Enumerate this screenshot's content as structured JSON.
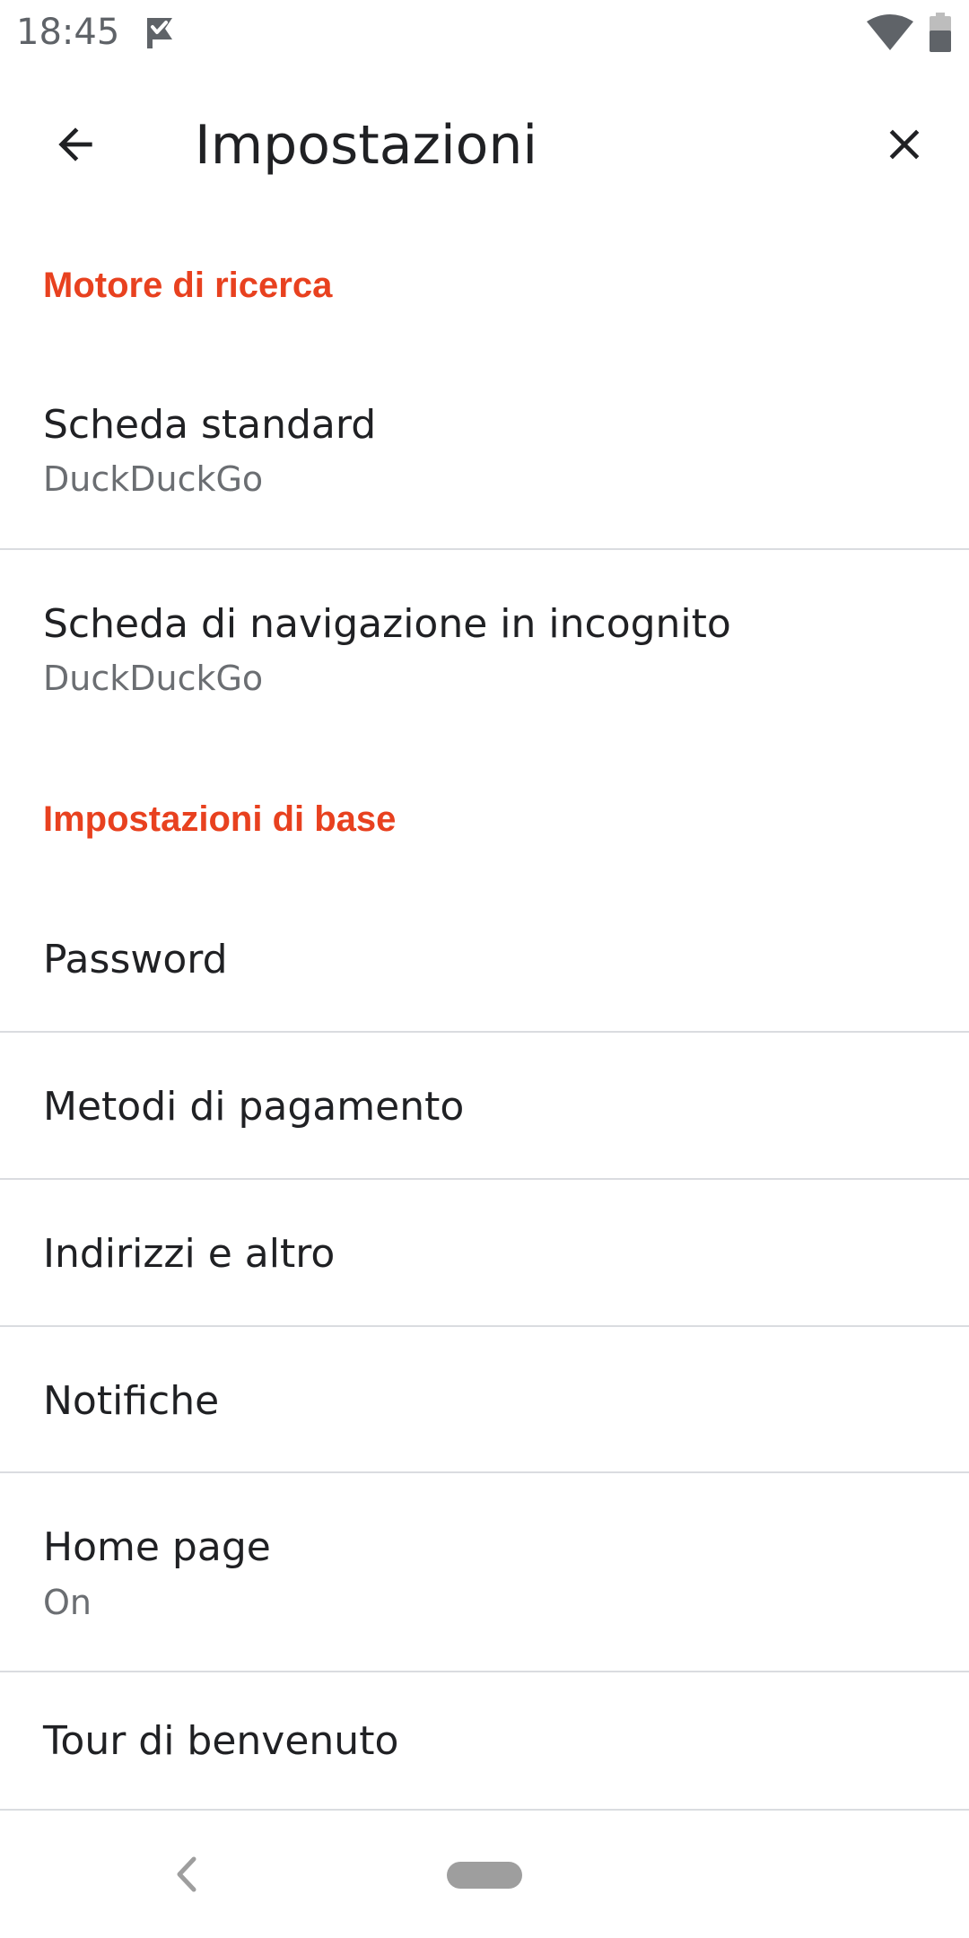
{
  "status_bar": {
    "time": "18:45",
    "app_icon": "check-flag-icon",
    "wifi_icon": "wifi-icon",
    "battery_icon": "battery-icon"
  },
  "toolbar": {
    "title": "Impostazioni",
    "back_icon": "arrow-back-icon",
    "close_icon": "close-icon"
  },
  "sections": {
    "search_engine": {
      "header": "Motore di ricerca",
      "items": [
        {
          "title": "Scheda standard",
          "summary": "DuckDuckGo"
        },
        {
          "title": "Scheda di navigazione in incognito",
          "summary": "DuckDuckGo"
        }
      ]
    },
    "basics": {
      "header": "Impostazioni di base",
      "items": [
        {
          "title": "Password"
        },
        {
          "title": "Metodi di pagamento"
        },
        {
          "title": "Indirizzi e altro"
        },
        {
          "title": "Notifiche"
        },
        {
          "title": "Home page",
          "summary": "On"
        },
        {
          "title": "Tour di benvenuto"
        }
      ]
    }
  },
  "colors": {
    "accent": "#e8411f",
    "text_primary": "#202124",
    "text_secondary": "#6b6e72",
    "divider": "#dadce0"
  },
  "nav_bar": {
    "back_icon": "nav-back-chevron-icon",
    "home_icon": "nav-home-pill-icon"
  }
}
